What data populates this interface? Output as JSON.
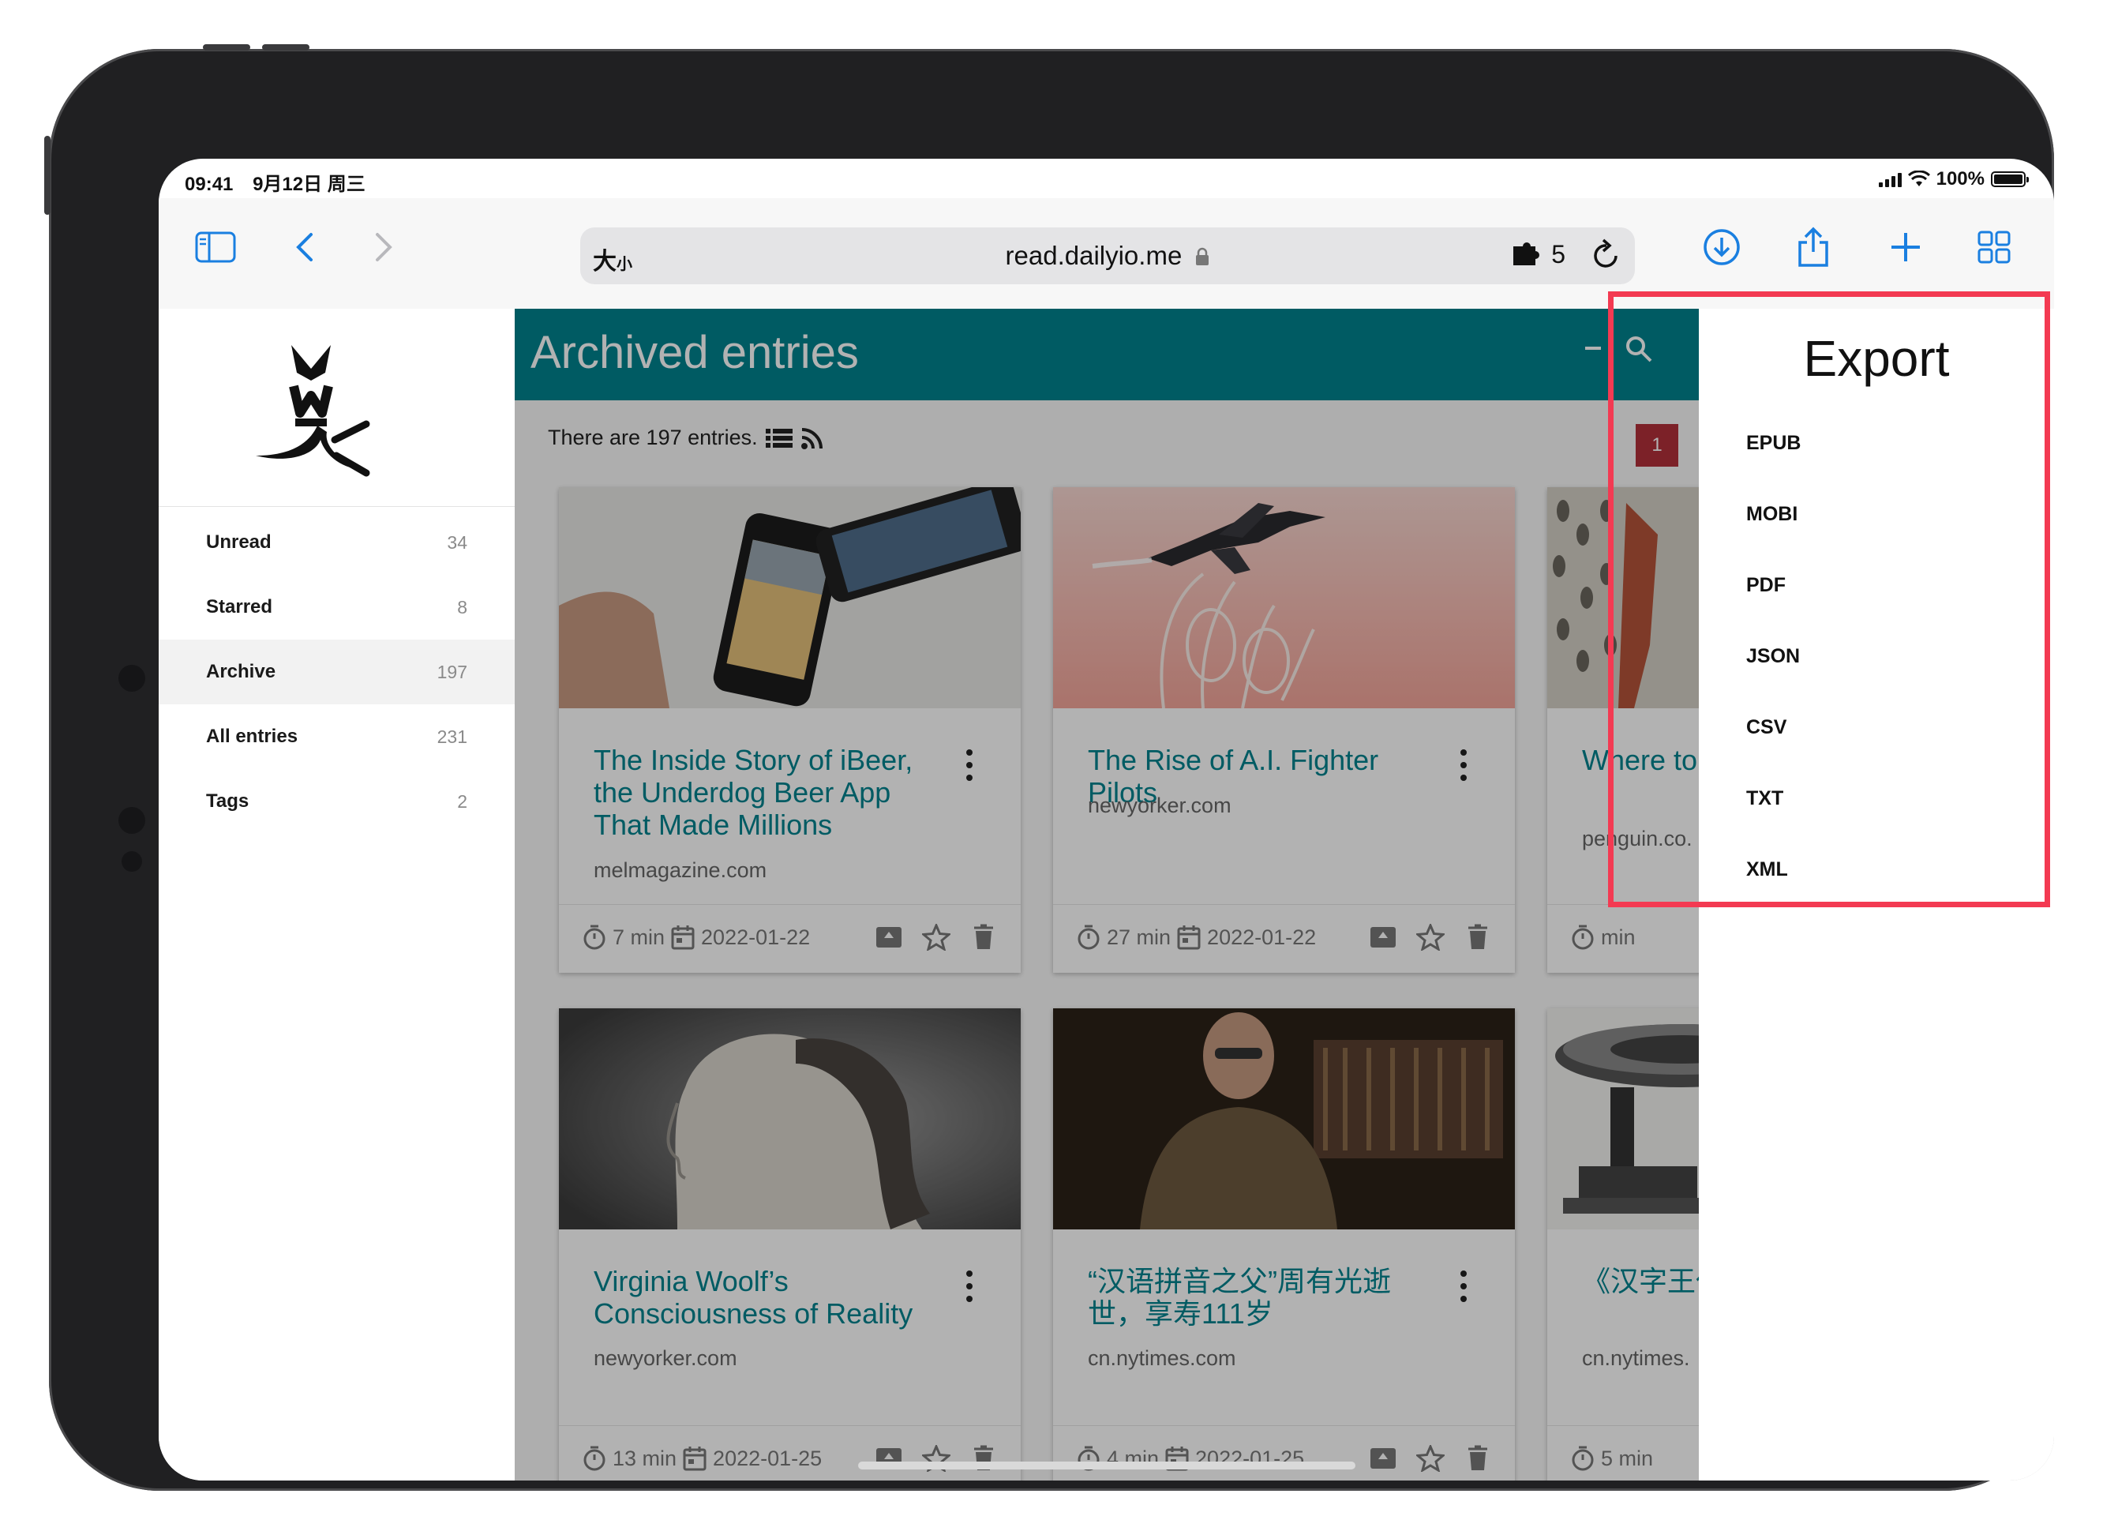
{
  "status_bar": {
    "time": "09:41",
    "date": "9月12日 周三",
    "battery": "100%"
  },
  "address_bar": {
    "text_size_label": "大",
    "text_size_small": "小",
    "url": "read.dailyio.me",
    "extensions_count": "5"
  },
  "sidebar": {
    "items": [
      {
        "label": "Unread",
        "count": "34"
      },
      {
        "label": "Starred",
        "count": "8"
      },
      {
        "label": "Archive",
        "count": "197"
      },
      {
        "label": "All entries",
        "count": "231"
      },
      {
        "label": "Tags",
        "count": "2"
      }
    ]
  },
  "main": {
    "title": "Archived entries",
    "entries_text": "There are 197 entries.",
    "pagination": {
      "current_page": "1"
    },
    "cards": [
      {
        "title": "The Inside Story of iBeer, the Underdog Beer App That Made Millions",
        "domain": "melmagazine.com",
        "reading_time": "7 min",
        "date": "2022-01-22"
      },
      {
        "title": "The Rise of A.I. Fighter Pilots",
        "domain": "newyorker.com",
        "reading_time": "27 min",
        "date": "2022-01-22"
      },
      {
        "title": "Where to Woolf",
        "domain": "penguin.co.",
        "reading_time": "min",
        "date": ""
      },
      {
        "title": "Virginia Woolf’s Consciousness of Reality",
        "domain": "newyorker.com",
        "reading_time": "13 min",
        "date": "2022-01-25"
      },
      {
        "title": "“汉语拼音之父”周有光逝世，享寿111岁",
        "domain": "cn.nytimes.com",
        "reading_time": "4 min",
        "date": "2022-01-25"
      },
      {
        "title": "《汉字王代中国的",
        "domain": "cn.nytimes.",
        "reading_time": "5 min",
        "date": ""
      }
    ]
  },
  "export_panel": {
    "title": "Export",
    "formats": [
      "EPUB",
      "MOBI",
      "PDF",
      "JSON",
      "CSV",
      "TXT",
      "XML"
    ]
  },
  "colors": {
    "header": "#00838f",
    "highlight": "#f33a52",
    "link": "#00838f",
    "page_badge": "#b2303a"
  }
}
